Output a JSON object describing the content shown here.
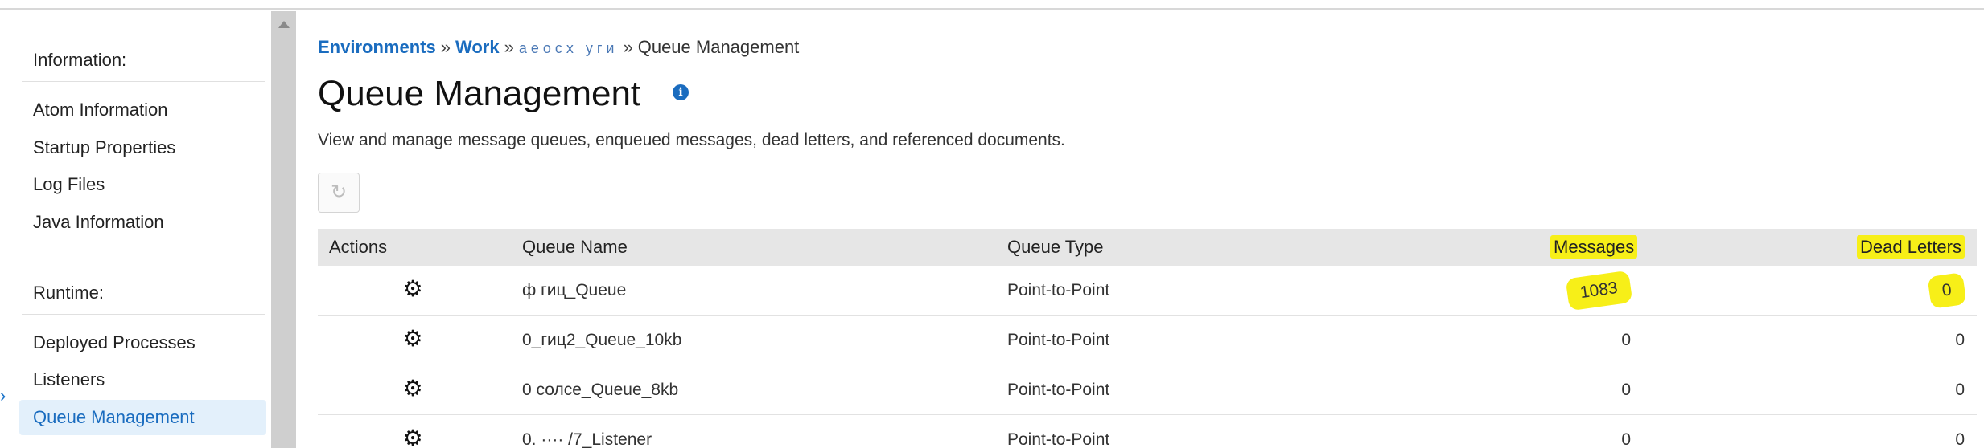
{
  "sidebar": {
    "information_header": "Information:",
    "information_items": [
      {
        "label": "Atom Information"
      },
      {
        "label": "Startup Properties"
      },
      {
        "label": "Log Files"
      },
      {
        "label": "Java Information"
      }
    ],
    "runtime_header": "Runtime:",
    "runtime_items": [
      {
        "label": "Deployed Processes"
      },
      {
        "label": "Listeners"
      },
      {
        "label": "Queue Management"
      }
    ]
  },
  "breadcrumb": {
    "environments": "Environments",
    "work": "Work",
    "masked": "аеосх уги",
    "current": "Queue Management",
    "separator": "»"
  },
  "page": {
    "title": "Queue Management",
    "info_icon": "i",
    "description": "View and manage message queues, enqueued messages, dead letters, and referenced documents."
  },
  "toolbar": {
    "refresh_icon": "↻"
  },
  "table": {
    "headers": {
      "actions": "Actions",
      "queue_name": "Queue Name",
      "queue_type": "Queue Type",
      "messages": "Messages",
      "dead_letters": "Dead Letters"
    },
    "gear_icon": "⚙",
    "rows": [
      {
        "queue_name": "ф гиц_Queue",
        "queue_type": "Point-to-Point",
        "messages": "1083",
        "dead_letters": "0"
      },
      {
        "queue_name": "0_гиц2_Queue_10kb",
        "queue_type": "Point-to-Point",
        "messages": "0",
        "dead_letters": "0"
      },
      {
        "queue_name": "0 солсе_Queue_8kb",
        "queue_type": "Point-to-Point",
        "messages": "0",
        "dead_letters": "0"
      },
      {
        "queue_name": "0. ···· /7_Listener",
        "queue_type": "Point-to-Point",
        "messages": "0",
        "dead_letters": "0"
      }
    ]
  },
  "colors": {
    "accent": "#1a6cbf",
    "highlight": "#f7ef18",
    "active_bg": "#e3f0fb"
  }
}
